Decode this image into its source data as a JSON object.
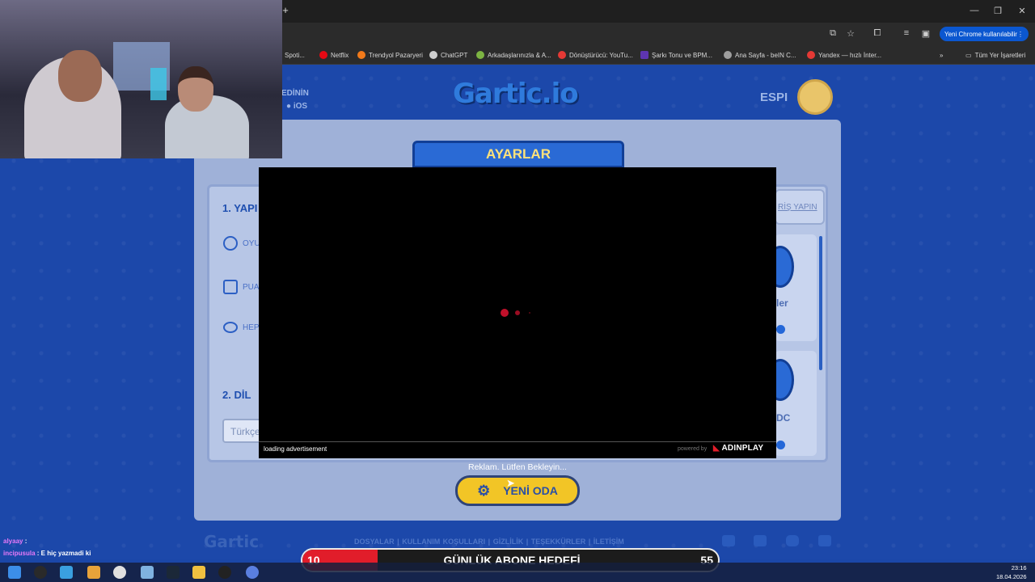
{
  "browser": {
    "new_chrome_badge": "Yeni Chrome kullanılabilir",
    "bookmarks": [
      {
        "label": "Spoti...",
        "color": "#1db954"
      },
      {
        "label": "Netflix",
        "color": "#e50914"
      },
      {
        "label": "Trendyol Pazaryeri",
        "color": "#f27a1a"
      },
      {
        "label": "ChatGPT",
        "color": "#cfcfcf"
      },
      {
        "label": "Arkadaşlarınızla & A...",
        "color": "#7cb342"
      },
      {
        "label": "Dönüştürücü: YouTu...",
        "color": "#e53935"
      },
      {
        "label": "Şarkı Tonu ve BPM...",
        "color": "#5e35b1"
      },
      {
        "label": "Ana Sayfa - beIN C...",
        "color": "#9e9e9e"
      },
      {
        "label": "Yandex — hızlı İnter...",
        "color": "#e53935"
      }
    ],
    "all_bookmarks": "Tüm Yer İşaretleri"
  },
  "site": {
    "logo": "Gartic.io",
    "username": "ESPI",
    "download_text": "EDİNİN",
    "ios_label": "iOS",
    "settings_ribbon": "AYARLAR",
    "section1": "1. YAPI",
    "options": [
      "OYU",
      "PUA",
      "HEP"
    ],
    "section2": "2. DİL",
    "language_value": "Türkçe",
    "login_link": "RİŞ YAPIN",
    "right_cards": [
      {
        "label": "ler"
      },
      {
        "label": "DC"
      }
    ],
    "new_room_button": "YENİ ODA",
    "footer_logo": "Gartic",
    "footer_links": "DOSYALAR  |  KULLANIM KOŞULLARI  |  GİZLİLİK  |  TEŞEKKÜRLER  |  İLETİŞİM"
  },
  "ad": {
    "loading_text": "loading advertisement",
    "powered_by": "powered by",
    "brand": "ADINPLAY",
    "wait_message": "Reklam. Lütfen Bekleyin..."
  },
  "chat": [
    {
      "user": "alyaay",
      "message": ""
    },
    {
      "user": "incipusula",
      "message": "E hiç yazmadi ki"
    }
  ],
  "subscriber_goal": {
    "current": "10",
    "title": "GÜNLÜK ABONE HEDEFİ",
    "target": "55",
    "progress_fraction": 0.18
  },
  "system": {
    "time": "23:16",
    "date": "18.04.2026"
  }
}
